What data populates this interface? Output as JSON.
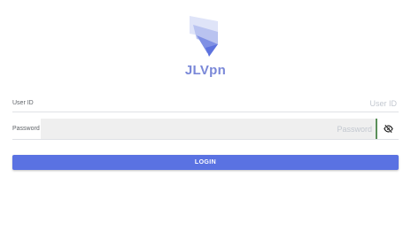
{
  "app": {
    "name": "JLVpn",
    "logo_icon": "jlvpn-logo-icon",
    "brand_color": "#7a88d8"
  },
  "form": {
    "user_id": {
      "label": "User ID",
      "value": "",
      "placeholder": "User ID"
    },
    "password": {
      "label": "Password",
      "value": "",
      "placeholder": "Password",
      "toggle_icon": "eye-slash-icon"
    },
    "login_button": {
      "label": "LOGIN",
      "color": "#5a72e2"
    }
  }
}
